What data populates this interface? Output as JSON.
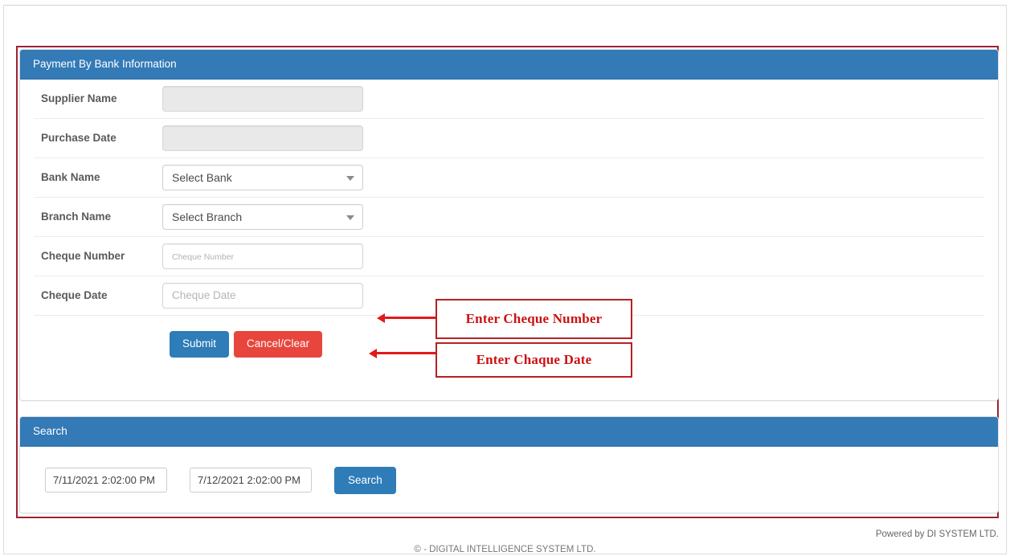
{
  "form_panel": {
    "title": "Payment By Bank Information",
    "rows": [
      {
        "label": "Supplier Name",
        "type": "text",
        "value": "",
        "placeholder": "",
        "disabled": true
      },
      {
        "label": "Purchase Date",
        "type": "text",
        "value": "",
        "placeholder": "",
        "disabled": true
      },
      {
        "label": "Bank Name",
        "type": "select",
        "value": "Select Bank"
      },
      {
        "label": "Branch Name",
        "type": "select",
        "value": "Select Branch"
      },
      {
        "label": "Cheque Number",
        "type": "text",
        "value": "",
        "placeholder": "Cheque Number",
        "disabled": false
      },
      {
        "label": "Cheque Date",
        "type": "text",
        "value": "",
        "placeholder": "Cheque Date",
        "disabled": false
      }
    ],
    "submit_label": "Submit",
    "cancel_label": "Cancel/Clear"
  },
  "annotations": [
    {
      "text": "Enter Cheque Number"
    },
    {
      "text": "Enter Chaque Date"
    }
  ],
  "search_panel": {
    "title": "Search",
    "from_date": "7/11/2021 2:02:00 PM",
    "to_date": "7/12/2021 2:02:00 PM",
    "search_label": "Search"
  },
  "footer": {
    "powered": "Powered by DI SYSTEM LTD.",
    "copyright": "©  - DIGITAL INTELLIGENCE SYSTEM LTD."
  },
  "colors": {
    "panel_header_blue": "#337ab7",
    "submit_blue": "#2e7cb8",
    "cancel_red": "#e8453c",
    "annotation_red": "#cc1111",
    "outline_red": "#9d2235"
  }
}
